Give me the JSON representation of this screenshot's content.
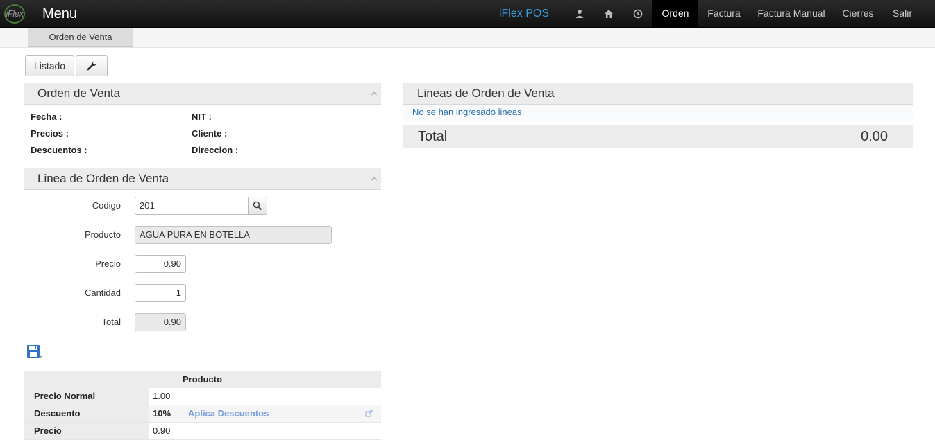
{
  "navbar": {
    "logo_text": "iFlex",
    "menu_title": "Menu",
    "brand": "iFlex POS",
    "icons": [
      "user-icon",
      "home-icon",
      "clock-icon"
    ],
    "items": [
      {
        "label": "Orden",
        "active": true
      },
      {
        "label": "Factura",
        "active": false
      },
      {
        "label": "Factura Manual",
        "active": false
      },
      {
        "label": "Cierres",
        "active": false
      },
      {
        "label": "Salir",
        "active": false
      }
    ]
  },
  "subtab": {
    "label": "Orden de Venta"
  },
  "toolbar": {
    "listado_label": "Listado",
    "settings_icon": "wrench-icon"
  },
  "orden_panel": {
    "title": "Orden de Venta",
    "fields": {
      "fecha": "Fecha :",
      "precios": "Precios :",
      "descuentos": "Descuentos :",
      "nit": "NIT :",
      "cliente": "Cliente :",
      "direccion": "Direccion :"
    }
  },
  "linea_panel": {
    "title": "Linea de Orden de Venta",
    "codigo_label": "Codigo",
    "codigo_value": "201",
    "producto_label": "Producto",
    "producto_value": "AGUA PURA EN BOTELLA",
    "precio_label": "Precio",
    "precio_value": "0.90",
    "cantidad_label": "Cantidad",
    "cantidad_value": "1",
    "total_label": "Total",
    "total_value": "0.90"
  },
  "producto_table": {
    "header": "Producto",
    "rows": [
      {
        "key": "Precio Normal",
        "value": "1.00"
      },
      {
        "key": "Descuento",
        "value": "10%",
        "link": "Aplica Descuentos"
      },
      {
        "key": "Precio",
        "value": "0.90"
      }
    ]
  },
  "lineas_panel": {
    "title": "Lineas de Orden de Venta",
    "empty_message": "No se han ingresado lineas",
    "total_label": "Total",
    "total_value": "0.00"
  },
  "colors": {
    "navbar": "#1c1c1c",
    "brand": "#3b9cd8",
    "link": "#7a9ede",
    "panel_header": "#ececec"
  }
}
